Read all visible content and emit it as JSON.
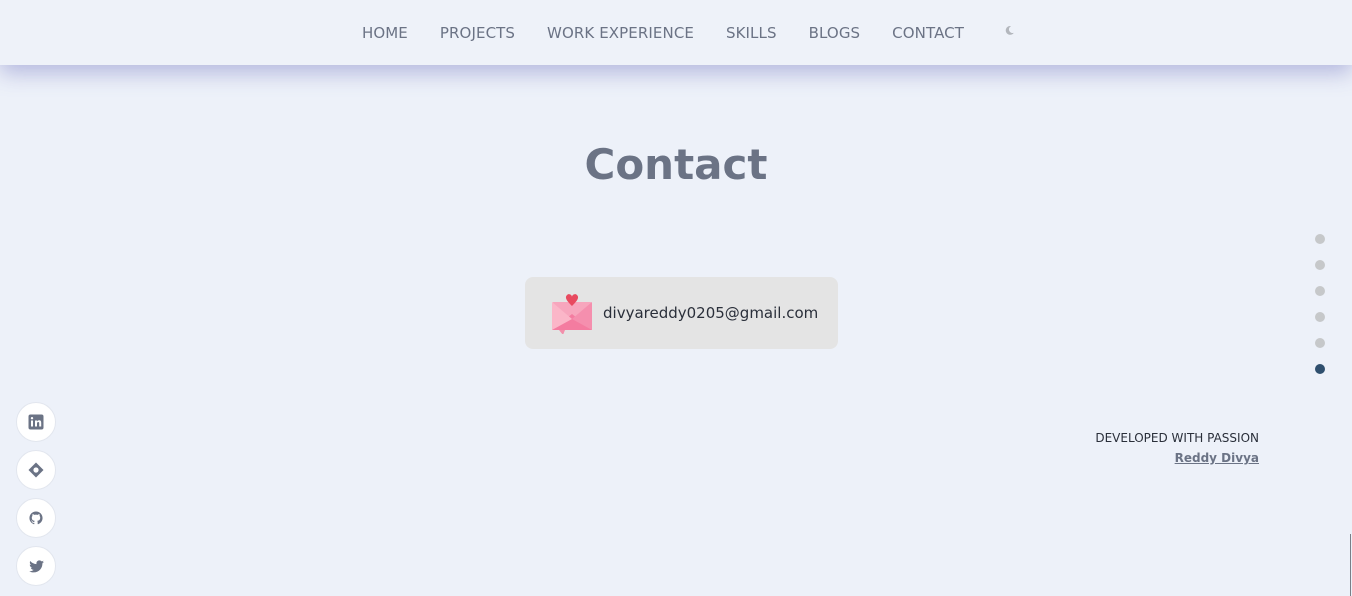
{
  "nav": {
    "items": [
      {
        "label": "HOME"
      },
      {
        "label": "PROJECTS"
      },
      {
        "label": "WORK EXPERIENCE"
      },
      {
        "label": "SKILLS"
      },
      {
        "label": "BLOGS"
      },
      {
        "label": "CONTACT"
      }
    ],
    "theme_toggle_icon": "moon-icon"
  },
  "main": {
    "title": "Contact",
    "email": {
      "address": "divyareddy0205@gmail.com",
      "icon": "love-letter-icon"
    }
  },
  "section_dots": {
    "count": 6,
    "active_index": 5,
    "active_color": "#2f4f6e",
    "inactive_color": "#c6c8ca"
  },
  "footer": {
    "tagline": "DEVELOPED WITH PASSION",
    "author": "Reddy Divya"
  },
  "social": [
    {
      "icon": "linkedin-icon"
    },
    {
      "icon": "hashnode-icon"
    },
    {
      "icon": "github-icon"
    },
    {
      "icon": "twitter-icon"
    }
  ],
  "colors": {
    "background": "#edf1f9",
    "nav_text": "#6b7385",
    "title": "#6b7385",
    "card": "#e4e4e4"
  }
}
